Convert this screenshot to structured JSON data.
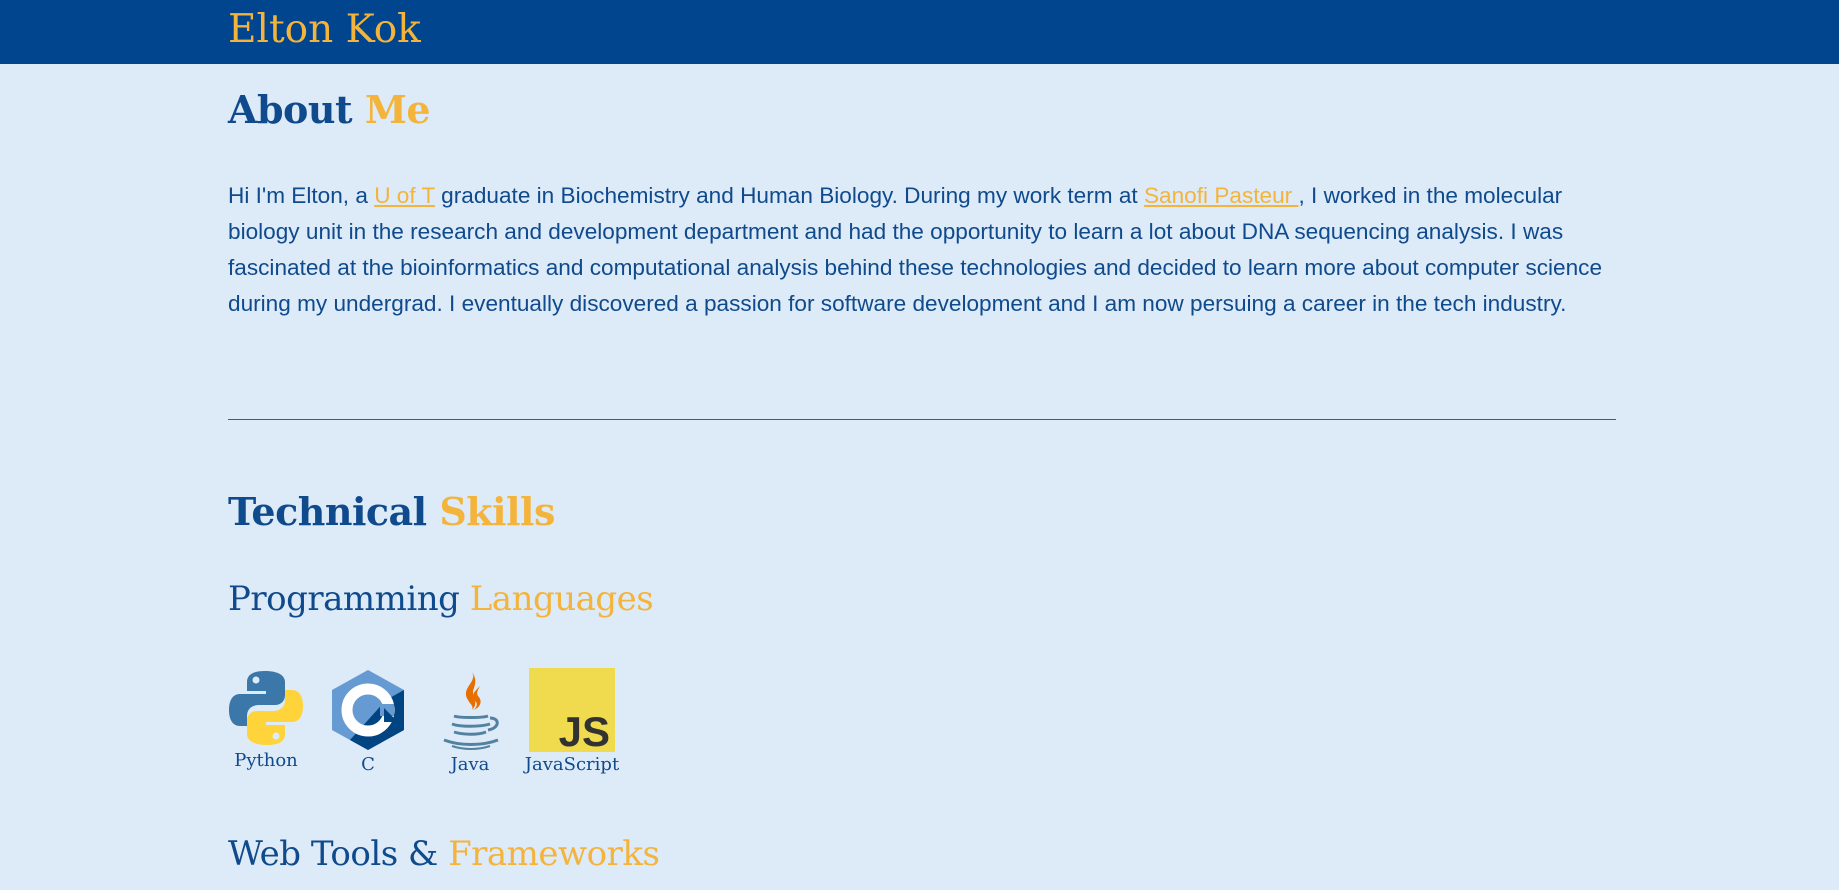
{
  "navbar": {
    "brand": "Elton Kok"
  },
  "about": {
    "heading_primary": "About",
    "heading_accent": "Me",
    "text_part1": "Hi I'm Elton, a ",
    "link_uoft": "U of T",
    "text_part2": " graduate in Biochemistry and Human Biology. During my work term at ",
    "link_sanofi": "Sanofi Pasteur ",
    "text_part3": ", I worked in the molecular biology unit in the research and development department and had the opportunity to learn a lot about DNA sequencing analysis. I was fascinated at the bioinformatics and computational analysis behind these technologies and decided to learn more about computer science during my undergrad. I eventually discovered a passion for software development and I am now persuing a career in the tech industry."
  },
  "skills": {
    "heading_primary": "Technical",
    "heading_accent": "Skills",
    "languages": {
      "heading_primary": "Programming",
      "heading_accent": "Languages",
      "items": [
        {
          "label": "Python",
          "icon": "python-icon"
        },
        {
          "label": "C",
          "icon": "c-icon"
        },
        {
          "label": "Java",
          "icon": "java-icon"
        },
        {
          "label": "JavaScript",
          "icon": "javascript-icon"
        }
      ]
    },
    "web": {
      "heading_primary": "Web Tools &",
      "heading_accent": "Frameworks"
    }
  },
  "colors": {
    "navbar_bg": "#00458e",
    "page_bg": "#ddeaf8",
    "primary_text": "#0f4a8c",
    "accent": "#f4b43b"
  }
}
